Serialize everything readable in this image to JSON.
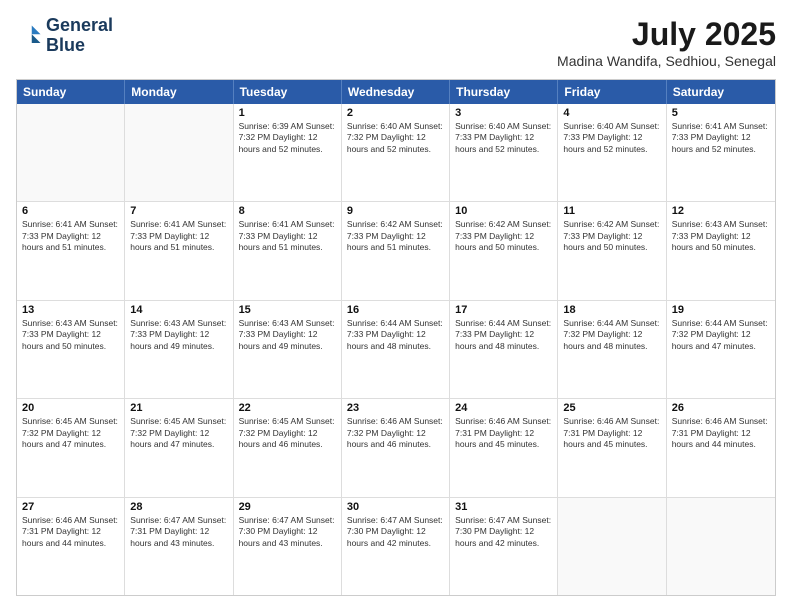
{
  "logo": {
    "line1": "General",
    "line2": "Blue"
  },
  "title": "July 2025",
  "location": "Madina Wandifa, Sedhiou, Senegal",
  "days_of_week": [
    "Sunday",
    "Monday",
    "Tuesday",
    "Wednesday",
    "Thursday",
    "Friday",
    "Saturday"
  ],
  "weeks": [
    [
      {
        "day": "",
        "info": ""
      },
      {
        "day": "",
        "info": ""
      },
      {
        "day": "1",
        "info": "Sunrise: 6:39 AM\nSunset: 7:32 PM\nDaylight: 12 hours and 52 minutes."
      },
      {
        "day": "2",
        "info": "Sunrise: 6:40 AM\nSunset: 7:32 PM\nDaylight: 12 hours and 52 minutes."
      },
      {
        "day": "3",
        "info": "Sunrise: 6:40 AM\nSunset: 7:33 PM\nDaylight: 12 hours and 52 minutes."
      },
      {
        "day": "4",
        "info": "Sunrise: 6:40 AM\nSunset: 7:33 PM\nDaylight: 12 hours and 52 minutes."
      },
      {
        "day": "5",
        "info": "Sunrise: 6:41 AM\nSunset: 7:33 PM\nDaylight: 12 hours and 52 minutes."
      }
    ],
    [
      {
        "day": "6",
        "info": "Sunrise: 6:41 AM\nSunset: 7:33 PM\nDaylight: 12 hours and 51 minutes."
      },
      {
        "day": "7",
        "info": "Sunrise: 6:41 AM\nSunset: 7:33 PM\nDaylight: 12 hours and 51 minutes."
      },
      {
        "day": "8",
        "info": "Sunrise: 6:41 AM\nSunset: 7:33 PM\nDaylight: 12 hours and 51 minutes."
      },
      {
        "day": "9",
        "info": "Sunrise: 6:42 AM\nSunset: 7:33 PM\nDaylight: 12 hours and 51 minutes."
      },
      {
        "day": "10",
        "info": "Sunrise: 6:42 AM\nSunset: 7:33 PM\nDaylight: 12 hours and 50 minutes."
      },
      {
        "day": "11",
        "info": "Sunrise: 6:42 AM\nSunset: 7:33 PM\nDaylight: 12 hours and 50 minutes."
      },
      {
        "day": "12",
        "info": "Sunrise: 6:43 AM\nSunset: 7:33 PM\nDaylight: 12 hours and 50 minutes."
      }
    ],
    [
      {
        "day": "13",
        "info": "Sunrise: 6:43 AM\nSunset: 7:33 PM\nDaylight: 12 hours and 50 minutes."
      },
      {
        "day": "14",
        "info": "Sunrise: 6:43 AM\nSunset: 7:33 PM\nDaylight: 12 hours and 49 minutes."
      },
      {
        "day": "15",
        "info": "Sunrise: 6:43 AM\nSunset: 7:33 PM\nDaylight: 12 hours and 49 minutes."
      },
      {
        "day": "16",
        "info": "Sunrise: 6:44 AM\nSunset: 7:33 PM\nDaylight: 12 hours and 48 minutes."
      },
      {
        "day": "17",
        "info": "Sunrise: 6:44 AM\nSunset: 7:33 PM\nDaylight: 12 hours and 48 minutes."
      },
      {
        "day": "18",
        "info": "Sunrise: 6:44 AM\nSunset: 7:32 PM\nDaylight: 12 hours and 48 minutes."
      },
      {
        "day": "19",
        "info": "Sunrise: 6:44 AM\nSunset: 7:32 PM\nDaylight: 12 hours and 47 minutes."
      }
    ],
    [
      {
        "day": "20",
        "info": "Sunrise: 6:45 AM\nSunset: 7:32 PM\nDaylight: 12 hours and 47 minutes."
      },
      {
        "day": "21",
        "info": "Sunrise: 6:45 AM\nSunset: 7:32 PM\nDaylight: 12 hours and 47 minutes."
      },
      {
        "day": "22",
        "info": "Sunrise: 6:45 AM\nSunset: 7:32 PM\nDaylight: 12 hours and 46 minutes."
      },
      {
        "day": "23",
        "info": "Sunrise: 6:46 AM\nSunset: 7:32 PM\nDaylight: 12 hours and 46 minutes."
      },
      {
        "day": "24",
        "info": "Sunrise: 6:46 AM\nSunset: 7:31 PM\nDaylight: 12 hours and 45 minutes."
      },
      {
        "day": "25",
        "info": "Sunrise: 6:46 AM\nSunset: 7:31 PM\nDaylight: 12 hours and 45 minutes."
      },
      {
        "day": "26",
        "info": "Sunrise: 6:46 AM\nSunset: 7:31 PM\nDaylight: 12 hours and 44 minutes."
      }
    ],
    [
      {
        "day": "27",
        "info": "Sunrise: 6:46 AM\nSunset: 7:31 PM\nDaylight: 12 hours and 44 minutes."
      },
      {
        "day": "28",
        "info": "Sunrise: 6:47 AM\nSunset: 7:31 PM\nDaylight: 12 hours and 43 minutes."
      },
      {
        "day": "29",
        "info": "Sunrise: 6:47 AM\nSunset: 7:30 PM\nDaylight: 12 hours and 43 minutes."
      },
      {
        "day": "30",
        "info": "Sunrise: 6:47 AM\nSunset: 7:30 PM\nDaylight: 12 hours and 42 minutes."
      },
      {
        "day": "31",
        "info": "Sunrise: 6:47 AM\nSunset: 7:30 PM\nDaylight: 12 hours and 42 minutes."
      },
      {
        "day": "",
        "info": ""
      },
      {
        "day": "",
        "info": ""
      }
    ]
  ]
}
